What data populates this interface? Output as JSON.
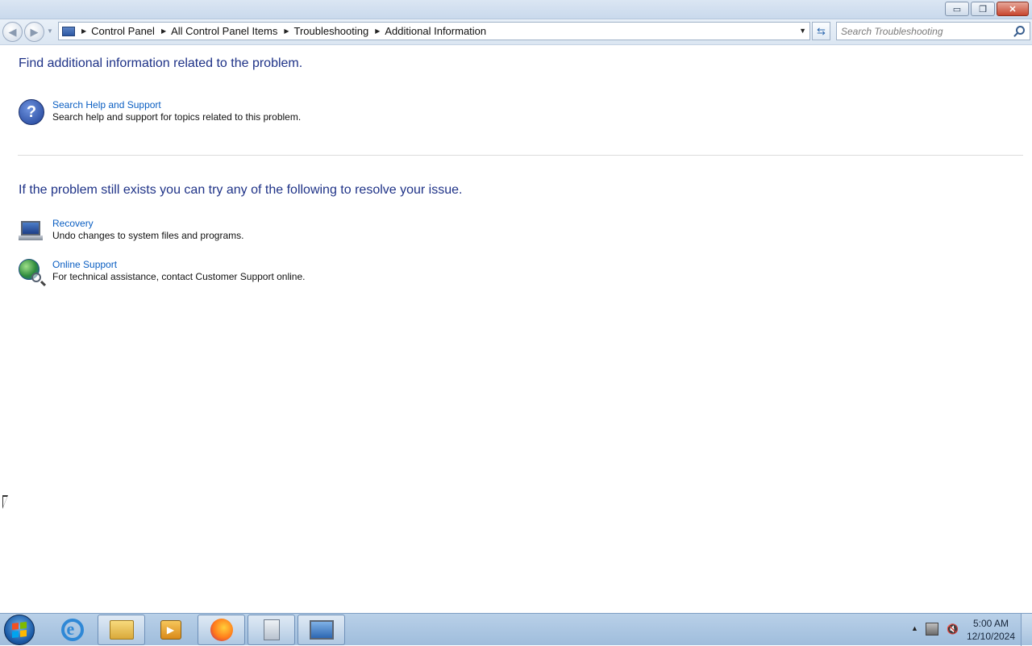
{
  "window": {
    "minimize_glyph": "▭",
    "restore_glyph": "❐",
    "close_glyph": "✕"
  },
  "nav": {
    "back_glyph": "◀",
    "forward_glyph": "▶"
  },
  "address": {
    "crumbs": [
      "Control Panel",
      "All Control Panel Items",
      "Troubleshooting",
      "Additional Information"
    ]
  },
  "search": {
    "placeholder": "Search Troubleshooting"
  },
  "content": {
    "heading1": "Find additional information related to the problem.",
    "help": {
      "link": "Search Help and Support",
      "description": "Search help and support for topics related to this problem.",
      "icon": "help-icon"
    },
    "heading2": "If the problem still exists you can try any of the following to resolve your issue.",
    "recovery": {
      "link": "Recovery",
      "description": "Undo changes to system files and programs.",
      "icon": "recovery-icon"
    },
    "online_support": {
      "link": "Online Support",
      "description": "For technical assistance, contact Customer Support online.",
      "icon": "globe-search-icon"
    }
  },
  "taskbar": {
    "items": [
      "internet-explorer",
      "file-explorer",
      "media-player",
      "firefox",
      "calculator",
      "control-panel"
    ],
    "clock_time": "5:00 AM",
    "clock_date": "12/10/2024"
  },
  "colors": {
    "heading": "#1e3287",
    "link": "#0a5ec2"
  }
}
